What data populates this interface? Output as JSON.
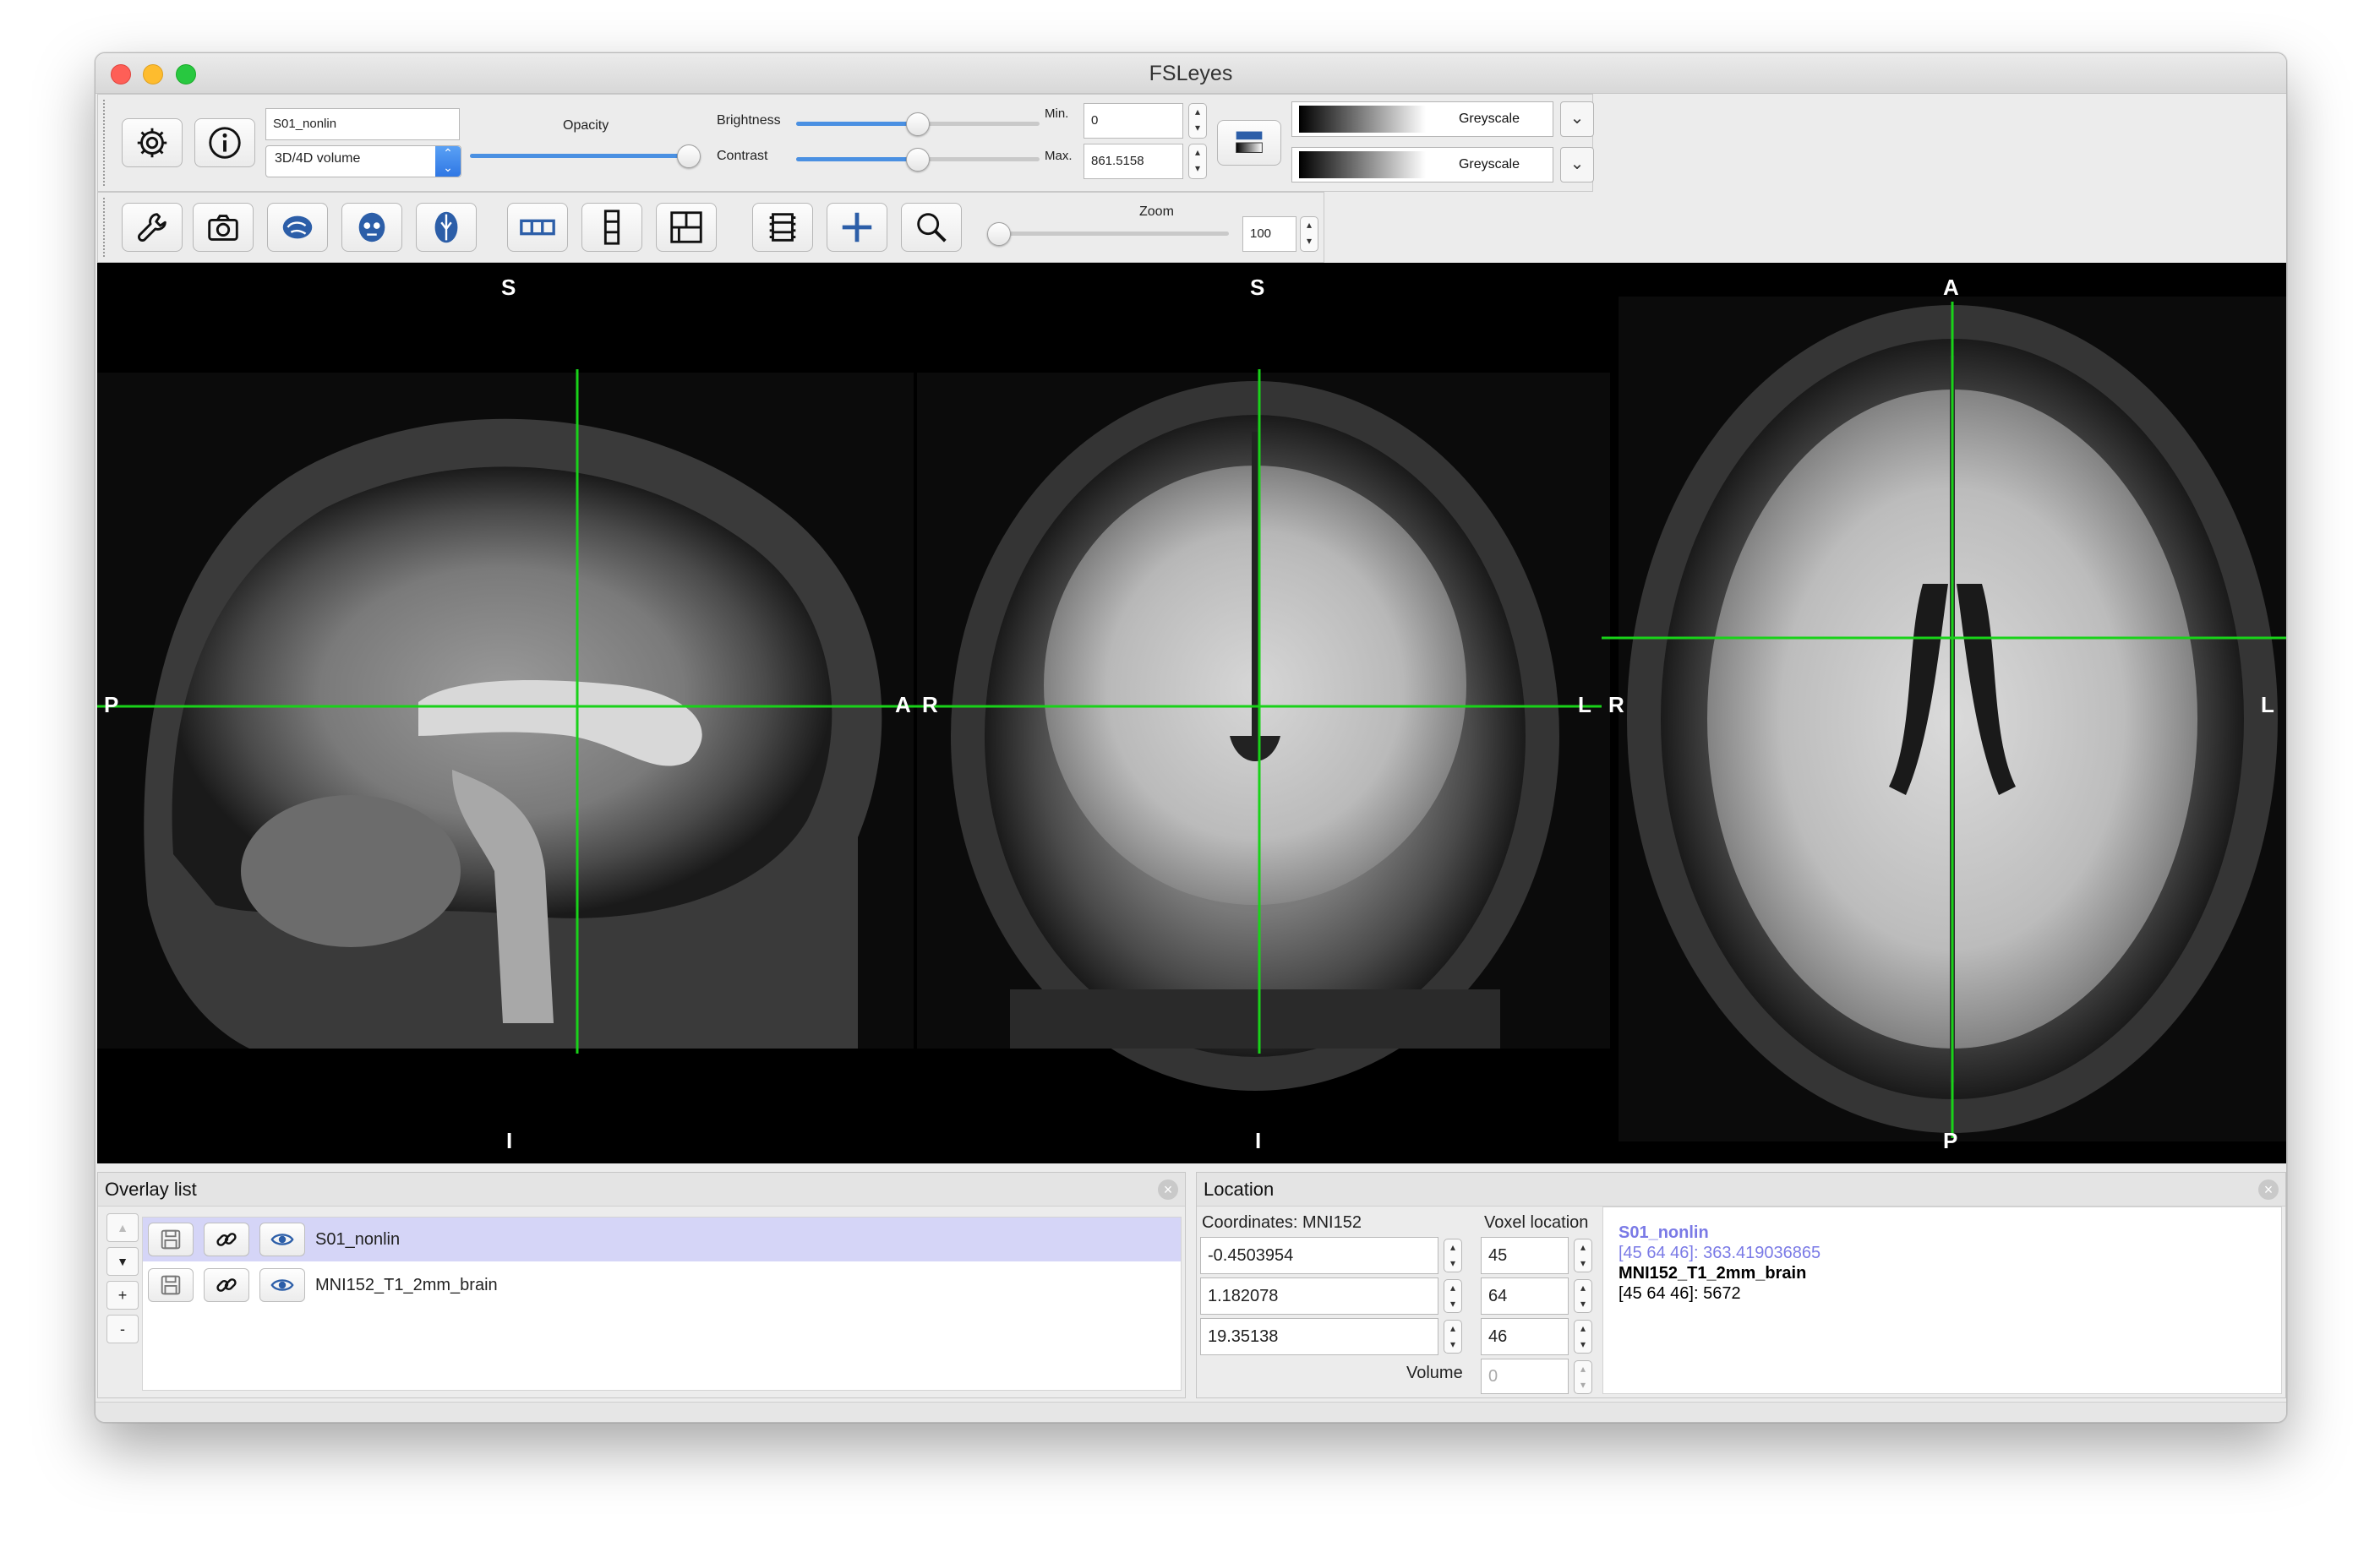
{
  "window": {
    "title": "FSLeyes"
  },
  "overlay_toolbar": {
    "overlay_name": "S01_nonlin",
    "overlay_type": "3D/4D volume",
    "opacity_label": "Opacity",
    "opacity_level": 0.96,
    "brightness_label": "Brightness",
    "brightness_level": 0.5,
    "contrast_label": "Contrast",
    "contrast_level": 0.5,
    "min_label": "Min.",
    "min_value": "0",
    "max_label": "Max.",
    "max_value": "861.5158",
    "cmap1": "Greyscale",
    "cmap2": "Greyscale"
  },
  "ortho_toolbar": {
    "zoom_label": "Zoom",
    "zoom_value": "100",
    "zoom_level": 0.0
  },
  "views": {
    "sagittal": {
      "top": "S",
      "bottom": "I",
      "left": "P",
      "right": "A"
    },
    "coronal": {
      "top": "S",
      "bottom": "I",
      "left": "R",
      "right": "L"
    },
    "axial": {
      "top": "A",
      "bottom": "P",
      "left": "R",
      "right": "L"
    }
  },
  "overlay_list": {
    "title": "Overlay list",
    "up": "▲",
    "down": "▼",
    "add": "+",
    "remove": "-",
    "items": [
      {
        "name": "S01_nonlin",
        "selected": true
      },
      {
        "name": "MNI152_T1_2mm_brain",
        "selected": false
      }
    ]
  },
  "location": {
    "title": "Location",
    "coord_label": "Coordinates: MNI152",
    "voxel_label": "Voxel location",
    "coords": [
      "-0.4503954",
      "1.182078",
      "19.35138"
    ],
    "voxels": [
      "45",
      "64",
      "46"
    ],
    "volume_label": "Volume",
    "volume_value": "0",
    "info": [
      {
        "name": "S01_nonlin",
        "value": "[45 64 46]: 363.419036865",
        "color": "#7a7ae6"
      },
      {
        "name": "MNI152_T1_2mm_brain",
        "value": "[45 64 46]: 5672",
        "color": "#000000"
      }
    ]
  },
  "colors": {
    "crosshair": "#19d219",
    "selection": "#d5d5f7",
    "accent": "#4a90e2"
  }
}
